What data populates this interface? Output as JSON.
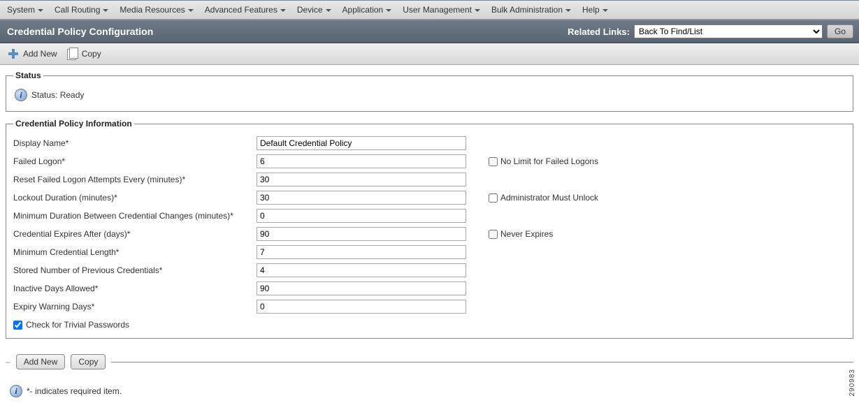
{
  "menubar": {
    "items": [
      {
        "label": "System"
      },
      {
        "label": "Call Routing"
      },
      {
        "label": "Media Resources"
      },
      {
        "label": "Advanced Features"
      },
      {
        "label": "Device"
      },
      {
        "label": "Application"
      },
      {
        "label": "User Management"
      },
      {
        "label": "Bulk Administration"
      },
      {
        "label": "Help"
      }
    ]
  },
  "header": {
    "title": "Credential Policy Configuration",
    "related_links_label": "Related Links:",
    "related_select": "Back To Find/List",
    "go_label": "Go"
  },
  "toolbar": {
    "add_new": "Add New",
    "copy": "Copy"
  },
  "status": {
    "legend": "Status",
    "text": "Status: Ready"
  },
  "form": {
    "legend": "Credential Policy Information",
    "rows": {
      "display_name": {
        "label": "Display Name*",
        "value": "Default Credential Policy"
      },
      "failed_logon": {
        "label": "Failed Logon*",
        "value": "6",
        "check_label": "No Limit for Failed Logons",
        "checked": false
      },
      "reset_attempts": {
        "label": "Reset Failed Logon Attempts Every (minutes)*",
        "value": "30"
      },
      "lockout_duration": {
        "label": "Lockout Duration (minutes)*",
        "value": "30",
        "check_label": "Administrator Must Unlock",
        "checked": false
      },
      "min_duration_changes": {
        "label": "Minimum Duration Between Credential Changes (minutes)*",
        "value": "0"
      },
      "expires_after": {
        "label": "Credential Expires After (days)*",
        "value": "90",
        "check_label": "Never Expires",
        "checked": false
      },
      "min_length": {
        "label": "Minimum Credential Length*",
        "value": "7"
      },
      "stored_prev": {
        "label": "Stored Number of Previous Credentials*",
        "value": "4"
      },
      "inactive_days": {
        "label": "Inactive Days Allowed*",
        "value": "90"
      },
      "expiry_warning": {
        "label": "Expiry Warning Days*",
        "value": "0"
      }
    },
    "trivial": {
      "label": "Check for Trivial Passwords",
      "checked": true
    }
  },
  "bottom": {
    "add_new": "Add New",
    "copy": "Copy"
  },
  "footnote": "*- indicates required item.",
  "image_id": "290983"
}
